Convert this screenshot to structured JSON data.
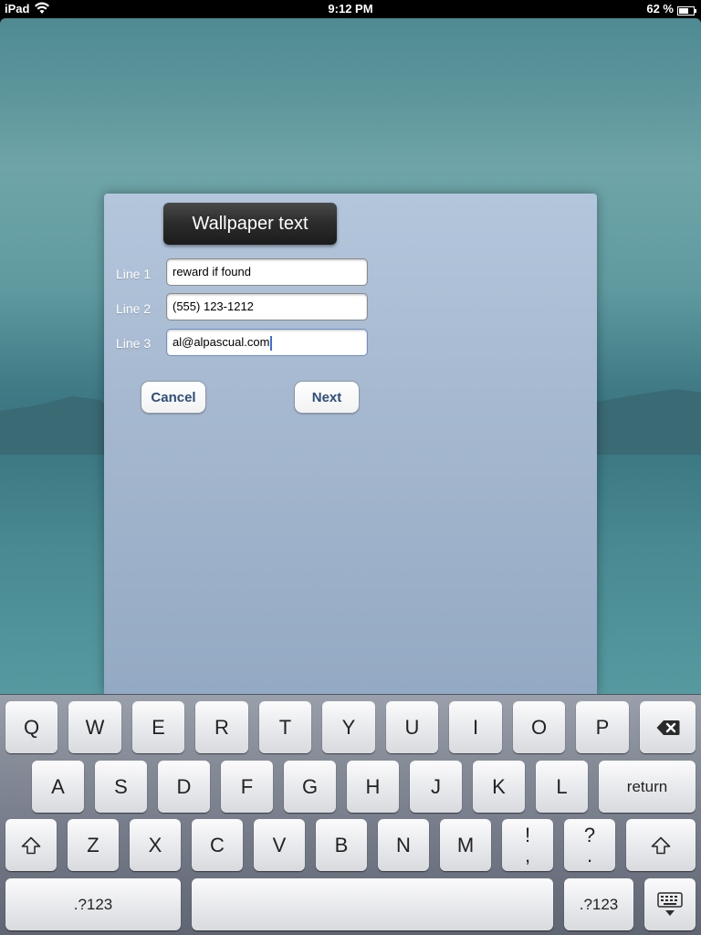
{
  "status_bar": {
    "carrier": "iPad",
    "time": "9:12 PM",
    "battery": "62 %"
  },
  "dialog": {
    "title": "Wallpaper text",
    "fields": [
      {
        "label": "Line 1",
        "value": "reward if found"
      },
      {
        "label": "Line 2",
        "value": "(555) 123-1212"
      },
      {
        "label": "Line 3",
        "value": "al@alpascual.com"
      }
    ],
    "cancel_label": "Cancel",
    "next_label": "Next"
  },
  "keyboard": {
    "row1": [
      "Q",
      "W",
      "E",
      "R",
      "T",
      "Y",
      "U",
      "I",
      "O",
      "P"
    ],
    "row2": [
      "A",
      "S",
      "D",
      "F",
      "G",
      "H",
      "J",
      "K",
      "L"
    ],
    "return_label": "return",
    "row3": [
      "Z",
      "X",
      "C",
      "V",
      "B",
      "N",
      "M"
    ],
    "punct1_top": "!",
    "punct1_bottom": ",",
    "punct2_top": "?",
    "punct2_bottom": ".",
    "numbers_label": ".?123",
    "icons": {
      "backspace": "backspace-icon",
      "shift": "shift-icon",
      "dismiss": "keyboard-dismiss-icon"
    }
  },
  "colors": {
    "button_text": "#2d4d7a",
    "caret": "#3a6fdc",
    "title_badge": "#2b2b2b"
  }
}
